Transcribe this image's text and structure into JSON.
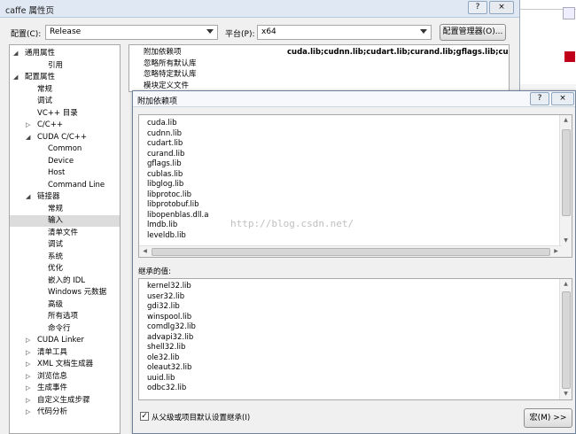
{
  "window": {
    "title": "caffe 属性页",
    "help_btn": "?",
    "close_btn": "×"
  },
  "toolbar": {
    "config_label": "配置(C):",
    "config_value": "Release",
    "platform_label": "平台(P):",
    "platform_value": "x64",
    "manager_button": "配置管理器(O)..."
  },
  "tree": [
    {
      "label": "通用属性",
      "level": 0,
      "expander": "◢"
    },
    {
      "label": "引用",
      "level": 2,
      "expander": ""
    },
    {
      "label": "配置属性",
      "level": 0,
      "expander": "◢"
    },
    {
      "label": "常规",
      "level": 1,
      "expander": ""
    },
    {
      "label": "调试",
      "level": 1,
      "expander": ""
    },
    {
      "label": "VC++ 目录",
      "level": 1,
      "expander": ""
    },
    {
      "label": "C/C++",
      "level": 1,
      "expander": "▷"
    },
    {
      "label": "CUDA C/C++",
      "level": 1,
      "expander": "◢"
    },
    {
      "label": "Common",
      "level": 2,
      "expander": ""
    },
    {
      "label": "Device",
      "level": 2,
      "expander": ""
    },
    {
      "label": "Host",
      "level": 2,
      "expander": ""
    },
    {
      "label": "Command Line",
      "level": 2,
      "expander": ""
    },
    {
      "label": "链接器",
      "level": 1,
      "expander": "◢"
    },
    {
      "label": "常规",
      "level": 2,
      "expander": ""
    },
    {
      "label": "输入",
      "level": 2,
      "expander": "",
      "selected": true
    },
    {
      "label": "清单文件",
      "level": 2,
      "expander": ""
    },
    {
      "label": "调试",
      "level": 2,
      "expander": ""
    },
    {
      "label": "系统",
      "level": 2,
      "expander": ""
    },
    {
      "label": "优化",
      "level": 2,
      "expander": ""
    },
    {
      "label": "嵌入的 IDL",
      "level": 2,
      "expander": ""
    },
    {
      "label": "Windows 元数据",
      "level": 2,
      "expander": ""
    },
    {
      "label": "高级",
      "level": 2,
      "expander": ""
    },
    {
      "label": "所有选项",
      "level": 2,
      "expander": ""
    },
    {
      "label": "命令行",
      "level": 2,
      "expander": ""
    },
    {
      "label": "CUDA Linker",
      "level": 1,
      "expander": "▷"
    },
    {
      "label": "清单工具",
      "level": 1,
      "expander": "▷"
    },
    {
      "label": "XML 文档生成器",
      "level": 1,
      "expander": "▷"
    },
    {
      "label": "浏览信息",
      "level": 1,
      "expander": "▷"
    },
    {
      "label": "生成事件",
      "level": 1,
      "expander": "▷"
    },
    {
      "label": "自定义生成步骤",
      "level": 1,
      "expander": "▷"
    },
    {
      "label": "代码分析",
      "level": 1,
      "expander": "▷"
    }
  ],
  "grid": [
    {
      "name": "附加依赖项",
      "value": "cuda.lib;cudnn.lib;cudart.lib;curand.lib;gflags.lib;cublas.lib;li"
    },
    {
      "name": "忽略所有默认库",
      "value": ""
    },
    {
      "name": "忽略特定默认库",
      "value": ""
    },
    {
      "name": "模块定义文件",
      "value": ""
    }
  ],
  "dialog": {
    "title": "附加依赖项",
    "help_btn": "?",
    "close_btn": "×",
    "deps": [
      "cuda.lib",
      "cudnn.lib",
      "cudart.lib",
      "curand.lib",
      "gflags.lib",
      "cublas.lib",
      "libglog.lib",
      "libprotoc.lib",
      "libprotobuf.lib",
      "libopenblas.dll.a",
      "lmdb.lib",
      "leveldb.lib"
    ],
    "inherited_label": "继承的值:",
    "inherited": [
      "kernel32.lib",
      "user32.lib",
      "gdi32.lib",
      "winspool.lib",
      "comdlg32.lib",
      "advapi32.lib",
      "shell32.lib",
      "ole32.lib",
      "oleaut32.lib",
      "uuid.lib",
      "odbc32.lib"
    ],
    "inherit_checkbox_label": "从父级或项目默认设置继承(I)",
    "inherit_checked": "✓",
    "macro_button": "宏(M) >>"
  },
  "watermark": "http://blog.csdn.net/"
}
